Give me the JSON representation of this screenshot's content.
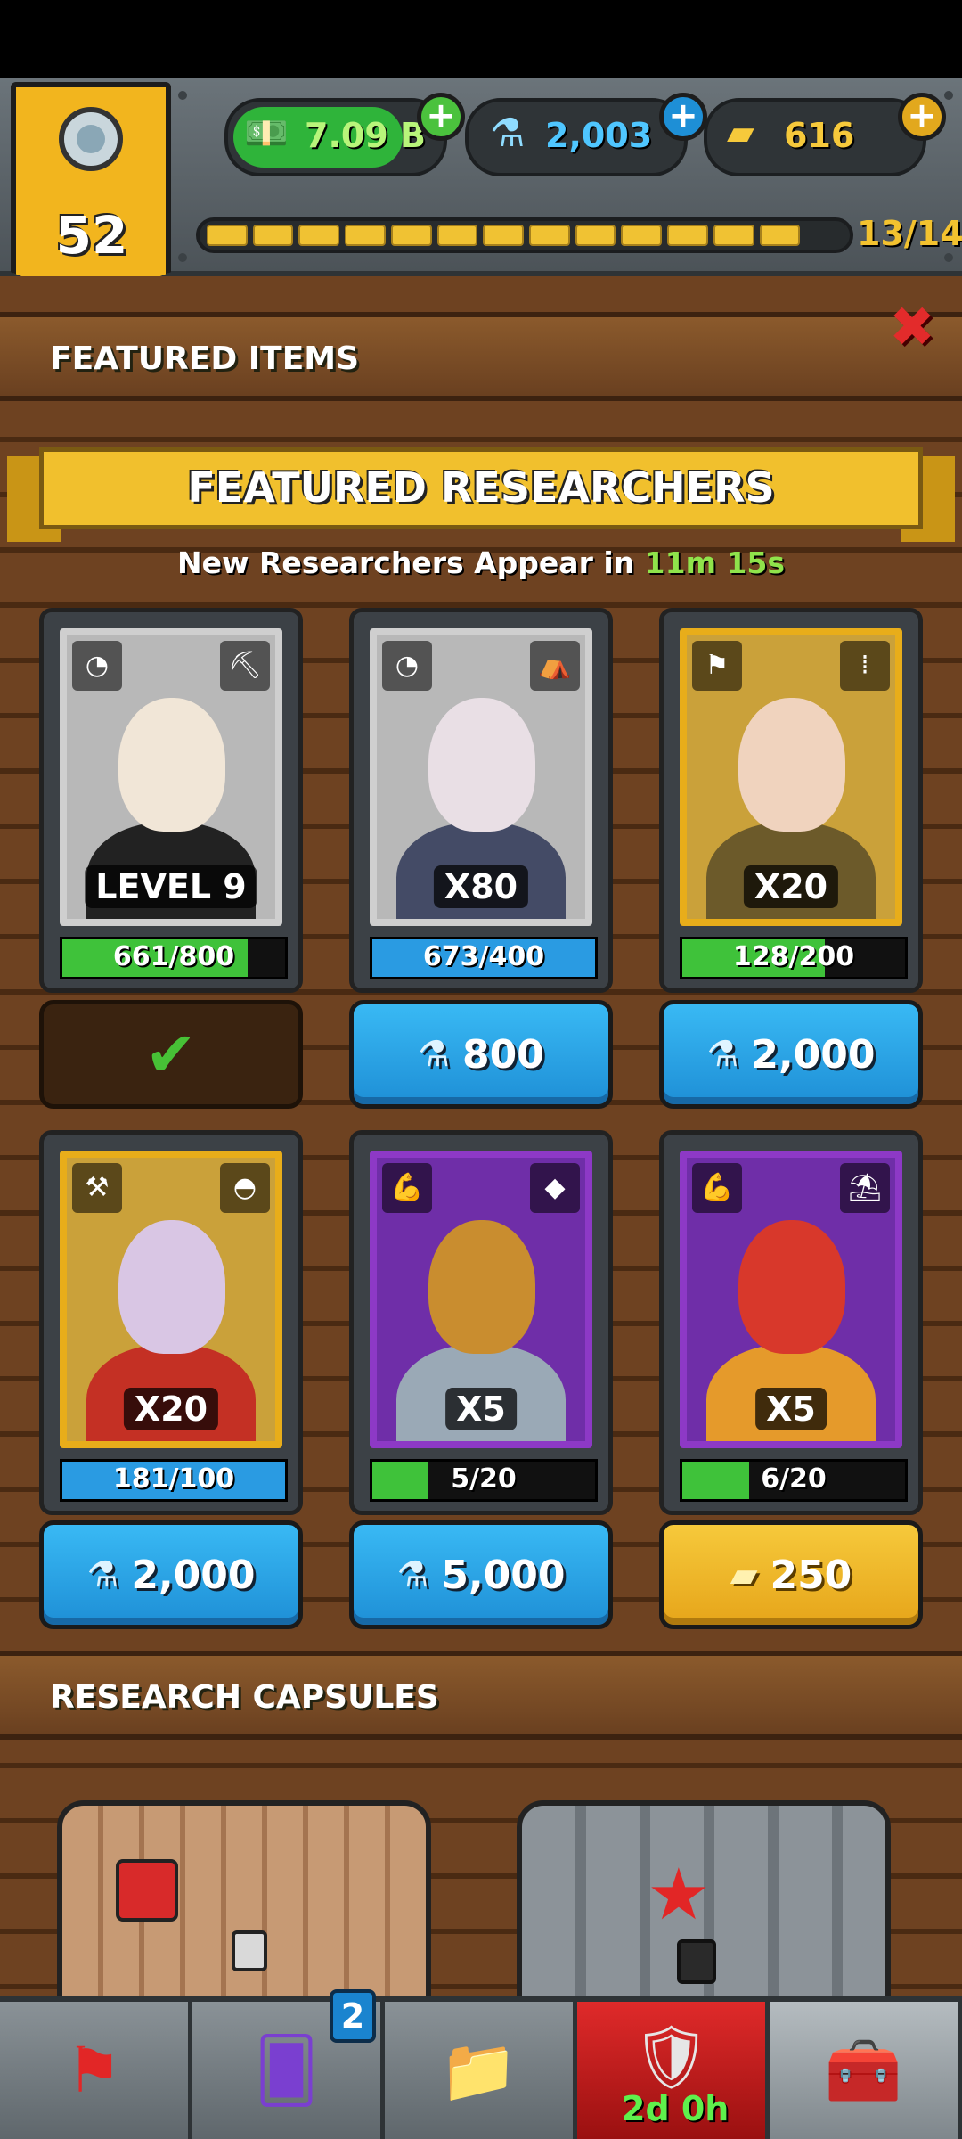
{
  "player": {
    "level": "52"
  },
  "currencies": {
    "cash": "7.09 B",
    "science": "2,003",
    "gold": "616"
  },
  "xp": {
    "text": "13/14",
    "filled": 13,
    "total": 14
  },
  "featured_items": {
    "title": "FEATURED ITEMS"
  },
  "featured_researchers": {
    "title": "FEATURED RESEARCHERS",
    "refresh_prefix": "New Researchers Appear in",
    "refresh_time": "11m 15s",
    "cards": [
      {
        "frame": "silver",
        "tag": "LEVEL 9",
        "progress_text": "661/800",
        "progress": 0.83,
        "progress_color": "#3fc23a",
        "icons": [
          "speedometer-icon",
          "excavator-icon"
        ],
        "head": "#f1e6d7",
        "body": "#222222",
        "button": {
          "type": "done",
          "label": "✔"
        }
      },
      {
        "frame": "silver",
        "tag": "X80",
        "progress_text": "673/400",
        "progress": 1.0,
        "progress_color": "#2a9be2",
        "icons": [
          "speedometer-icon",
          "tent-icon"
        ],
        "head": "#e9dfe5",
        "body": "#444b66",
        "button": {
          "type": "blue",
          "currency": "science",
          "label": "800"
        }
      },
      {
        "frame": "gold",
        "tag": "X20",
        "progress_text": "128/200",
        "progress": 0.64,
        "progress_color": "#3fc23a",
        "icons": [
          "flag-icon",
          "ammo-icon"
        ],
        "head": "#f0d3be",
        "body": "#6c5a2a",
        "button": {
          "type": "blue",
          "currency": "science",
          "label": "2,000"
        }
      },
      {
        "frame": "gold",
        "tag": "X20",
        "progress_text": "181/100",
        "progress": 1.0,
        "progress_color": "#2a9be2",
        "icons": [
          "shovel-icon",
          "hat-icon"
        ],
        "head": "#d9c6e4",
        "body": "#c43024",
        "button": {
          "type": "blue",
          "currency": "science",
          "label": "2,000"
        }
      },
      {
        "frame": "purple",
        "tag": "X5",
        "progress_text": "5/20",
        "progress": 0.25,
        "progress_color": "#3fc23a",
        "icons": [
          "muscle-icon",
          "rock-icon"
        ],
        "head": "#c98d2f",
        "body": "#9aa9b6",
        "button": {
          "type": "blue",
          "currency": "science",
          "label": "5,000"
        }
      },
      {
        "frame": "purple",
        "tag": "X5",
        "progress_text": "6/20",
        "progress": 0.3,
        "progress_color": "#3fc23a",
        "icons": [
          "muscle-icon",
          "island-icon"
        ],
        "head": "#d8382b",
        "body": "#e59a2b",
        "button": {
          "type": "yellow",
          "currency": "gold",
          "label": "250"
        }
      }
    ]
  },
  "research_capsules": {
    "title": "RESEARCH CAPSULES"
  },
  "nav": {
    "items": [
      "missions-icon",
      "cards-icon",
      "folder-icon",
      "battle-icon",
      "shop-icon"
    ],
    "cards_badge": "2",
    "battle_timer": "2d 0h"
  }
}
